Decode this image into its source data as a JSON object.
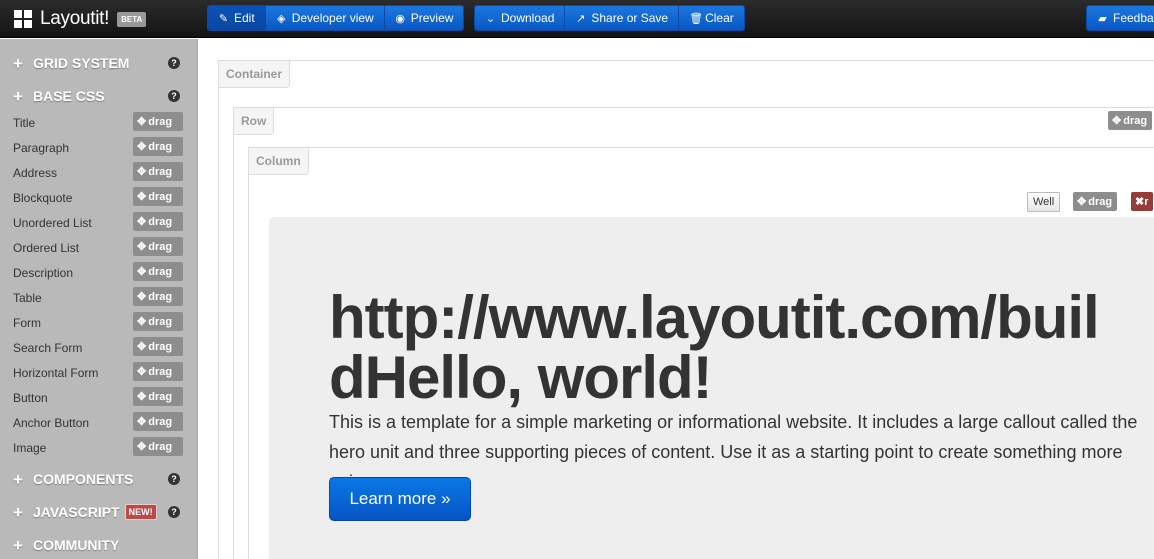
{
  "brand": {
    "name": "Layoutit!",
    "badge": "BETA"
  },
  "toolbar": {
    "mode_buttons": [
      {
        "label": "Edit",
        "icon": "edit-icon"
      },
      {
        "label": "Developer view",
        "icon": "eye-code-icon"
      },
      {
        "label": "Preview",
        "icon": "eye-icon"
      }
    ],
    "action_buttons": [
      {
        "label": "Download",
        "icon": "chevron-down-icon"
      },
      {
        "label": "Share or Save",
        "icon": "share-icon"
      },
      {
        "label": "Clear",
        "icon": "trash-icon"
      }
    ],
    "feedback": {
      "label": "Feedba",
      "icon": "comment-icon"
    }
  },
  "sidebar": {
    "sections": {
      "grid": {
        "title": "GRID SYSTEM",
        "help": "?"
      },
      "base_css": {
        "title": "BASE CSS",
        "help": "?"
      },
      "components": {
        "title": "COMPONENTS",
        "help": "?"
      },
      "javascript": {
        "title": "JAVASCRIPT",
        "badge": "NEW!",
        "help": "?"
      },
      "community": {
        "title": "COMMUNITY"
      }
    },
    "drag_label": "drag",
    "base_css_items": [
      "Title",
      "Paragraph",
      "Address",
      "Blockquote",
      "Unordered List",
      "Ordered List",
      "Description",
      "Table",
      "Form",
      "Search Form",
      "Horizontal Form",
      "Button",
      "Anchor Button",
      "Image"
    ]
  },
  "canvas": {
    "container_label": "Container",
    "row_label": "Row",
    "column_label": "Column",
    "row_drag": "drag",
    "well_button": "Well",
    "column_drag": "drag",
    "remove_label": "r",
    "hero": {
      "title": "http://www.layoutit.com/buildHello, world!",
      "text": "This is a template for a simple marketing or informational website. It includes a large callout called the hero unit and three supporting pieces of content. Use it as a starting point to create something more unique.",
      "button": "Learn more »"
    }
  },
  "colors": {
    "accent": "#0a5fcf",
    "sidebar_bg": "#b9b9b9",
    "drag_bg": "#8d8d8d",
    "remove_bg": "#953b39"
  }
}
